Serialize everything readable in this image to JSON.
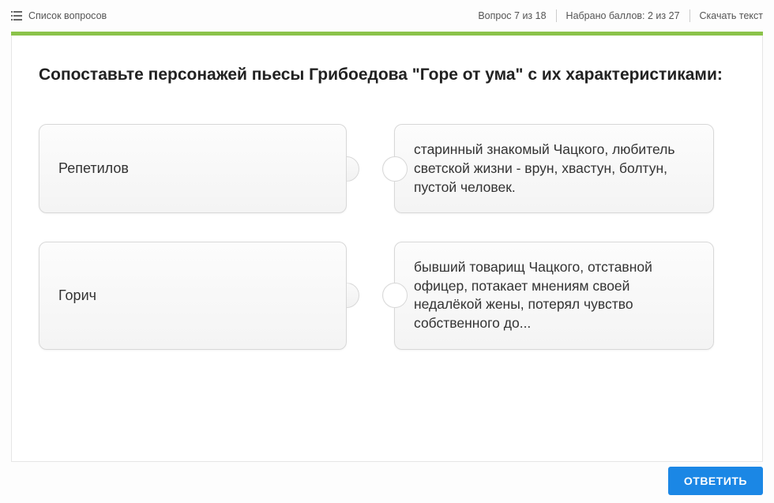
{
  "topbar": {
    "question_list_label": "Список вопросов",
    "question_counter": "Вопрос 7 из 18",
    "score": "Набрано баллов: 2 из 27",
    "download_text": "Скачать текст"
  },
  "question": {
    "title": "Сопоставьте персонажей пьесы Грибоедова \"Горе от ума\" с их характеристиками:"
  },
  "pairs": [
    {
      "left": "Репетилов",
      "right": "старинный знакомый Чацкого, любитель светской жизни - врун, хвастун, болтун, пустой человек."
    },
    {
      "left": "Горич",
      "right": "бывший товарищ Чацкого, отставной офицер, потакает мнениям своей недалёкой жены, потерял чувство собственного до..."
    }
  ],
  "buttons": {
    "answer": "ОТВЕТИТЬ"
  }
}
